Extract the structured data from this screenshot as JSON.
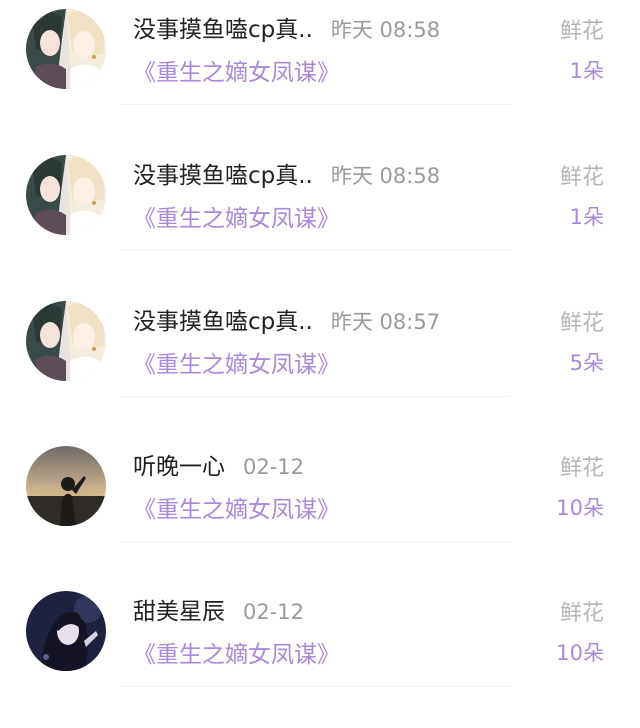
{
  "gifts": [
    {
      "user": "没事摸鱼嗑cp真..",
      "time": "昨天 08:58",
      "book": "《重生之嫡女凤谋》",
      "gift_label": "鲜花",
      "gift_count": "1朵",
      "avatar": "anime-couple-avatar"
    },
    {
      "user": "没事摸鱼嗑cp真..",
      "time": "昨天 08:58",
      "book": "《重生之嫡女凤谋》",
      "gift_label": "鲜花",
      "gift_count": "1朵",
      "avatar": "anime-couple-avatar"
    },
    {
      "user": "没事摸鱼嗑cp真..",
      "time": "昨天 08:57",
      "book": "《重生之嫡女凤谋》",
      "gift_label": "鲜花",
      "gift_count": "5朵",
      "avatar": "anime-couple-avatar"
    },
    {
      "user": "听晚一心",
      "time": "02-12",
      "book": "《重生之嫡女凤谋》",
      "gift_label": "鲜花",
      "gift_count": "10朵",
      "avatar": "sunset-girl-avatar"
    },
    {
      "user": "甜美星辰",
      "time": "02-12",
      "book": "《重生之嫡女凤谋》",
      "gift_label": "鲜花",
      "gift_count": "10朵",
      "avatar": "portrait-girl-avatar"
    }
  ],
  "colors": {
    "accent": "#a98ad8",
    "name_text": "#222222",
    "time_text": "#9a9a9a",
    "gift_label_text": "#b5b5b5"
  }
}
